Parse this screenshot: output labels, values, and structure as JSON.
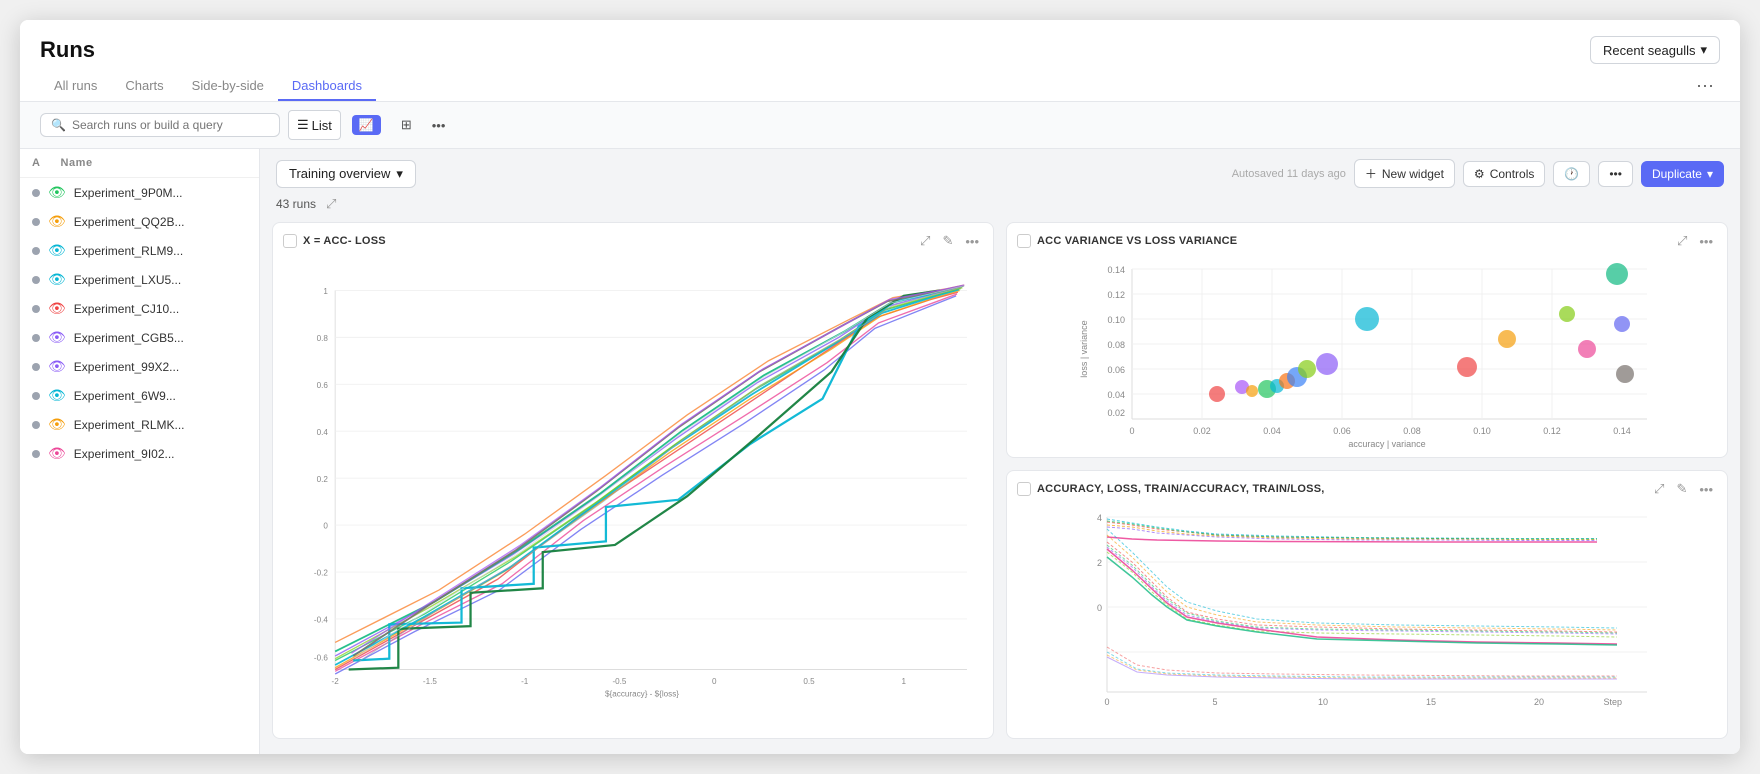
{
  "header": {
    "title": "Runs",
    "tabs": [
      {
        "label": "All runs",
        "active": false
      },
      {
        "label": "Charts",
        "active": false
      },
      {
        "label": "Side-by-side",
        "active": false
      },
      {
        "label": "Dashboards",
        "active": true
      }
    ],
    "recent_seagulls": "Recent seagulls",
    "menu_icon": "⋯"
  },
  "toolbar": {
    "search_placeholder": "Search runs or build a query",
    "list_label": "List",
    "view_icon1": "📊",
    "view_icon2": "⊞"
  },
  "dashboard": {
    "title": "Training overview",
    "runs_count": "43 runs",
    "autosaved": "Autosaved 11 days ago",
    "new_widget": "+ New widget",
    "controls": "Controls",
    "duplicate": "Duplicate"
  },
  "runs": [
    {
      "name": "Experiment_9P0M...",
      "color": "#22c55e",
      "dot": "#9ca3af"
    },
    {
      "name": "Experiment_QQ2B...",
      "color": "#f59e0b",
      "dot": "#9ca3af"
    },
    {
      "name": "Experiment_RLM9...",
      "color": "#06b6d4",
      "dot": "#9ca3af"
    },
    {
      "name": "Experiment_LXU5...",
      "color": "#06b6d4",
      "dot": "#9ca3af"
    },
    {
      "name": "Experiment_CJ10...",
      "color": "#ef4444",
      "dot": "#9ca3af"
    },
    {
      "name": "Experiment_CGB5...",
      "color": "#8b5cf6",
      "dot": "#9ca3af"
    },
    {
      "name": "Experiment_99X2...",
      "color": "#8b5cf6",
      "dot": "#9ca3af"
    },
    {
      "name": "Experiment_6W9...",
      "color": "#06b6d4",
      "dot": "#9ca3af"
    },
    {
      "name": "Experiment_RLMK...",
      "color": "#f59e0b",
      "dot": "#9ca3af"
    },
    {
      "name": "Experiment_9I02...",
      "color": "#ec4899",
      "dot": "#9ca3af"
    }
  ],
  "widgets": {
    "scatter": {
      "title": "ACC VARIANCE vs LOSS VARIANCE",
      "x_label": "accuracy | variance",
      "y_label": "loss | variance"
    },
    "line": {
      "title": "accuracy, loss, train/accuracy, train/loss,",
      "x_label": "Step"
    },
    "large": {
      "title": "x = acc- loss",
      "x_label": "${accuracy} - ${loss}",
      "y_label": ""
    }
  }
}
